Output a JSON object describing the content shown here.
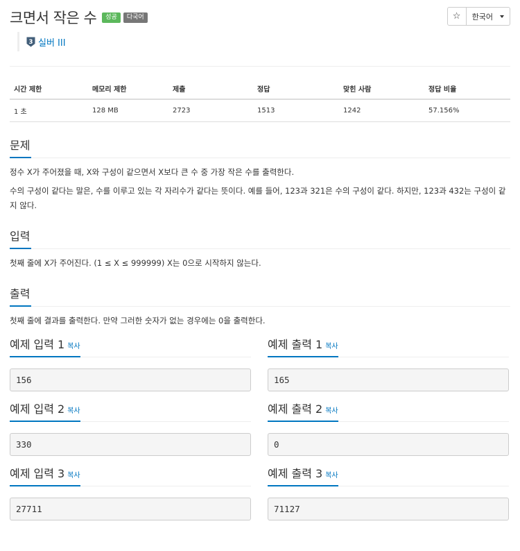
{
  "header": {
    "title": "크면서 작은 수",
    "badges": {
      "success": "성공",
      "multilang": "다국어"
    },
    "star_icon": "☆",
    "language": "한국어",
    "tier": {
      "number": "3",
      "label": "실버 III"
    }
  },
  "info_table": {
    "headers": [
      "시간 제한",
      "메모리 제한",
      "제출",
      "정답",
      "맞힌 사람",
      "정답 비율"
    ],
    "values": [
      "1 초",
      "128 MB",
      "2723",
      "1513",
      "1242",
      "57.156%"
    ]
  },
  "problem": {
    "title": "문제",
    "paragraphs": [
      "정수 X가 주어졌을 때, X와 구성이 같으면서 X보다 큰 수 중 가장 작은 수를 출력한다.",
      "수의 구성이 같다는 말은, 수를 이루고 있는 각 자리수가 같다는 뜻이다. 예를 들어, 123과 321은 수의 구성이 같다. 하지만, 123과 432는 구성이 같지 않다."
    ]
  },
  "input": {
    "title": "입력",
    "text": "첫째 줄에 X가 주어진다. (1 ≤ X ≤ 999999) X는 0으로 시작하지 않는다."
  },
  "output": {
    "title": "출력",
    "text": "첫째 줄에 결과를 출력한다. 만약 그러한 숫자가 없는 경우에는 0을 출력한다."
  },
  "samples": {
    "copy_label": "복사",
    "items": [
      {
        "in_title": "예제 입력 1",
        "in_value": "156",
        "out_title": "예제 출력 1",
        "out_value": "165"
      },
      {
        "in_title": "예제 입력 2",
        "in_value": "330",
        "out_title": "예제 출력 2",
        "out_value": "0"
      },
      {
        "in_title": "예제 입력 3",
        "in_value": "27711",
        "out_title": "예제 출력 3",
        "out_value": "71127"
      }
    ]
  },
  "colors": {
    "accent": "#0076c0",
    "success": "#5cb85c",
    "badge_gray": "#777777",
    "tier_silver": "#435f7a"
  }
}
